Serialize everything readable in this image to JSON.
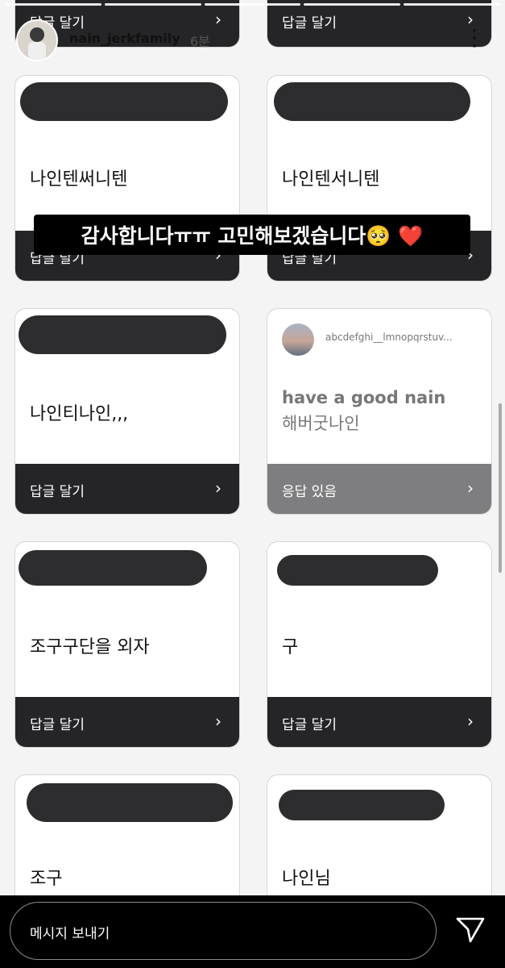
{
  "header": {
    "username": "nain_jerkfamily",
    "time": "6분",
    "more_icon": "⋮"
  },
  "caption": {
    "text": "감사합니다ㅠㅠ 고민해보겠습니다🥺 ❤️"
  },
  "cards": [
    {
      "question": "나인텐써니텐",
      "footer": "답글 달기"
    },
    {
      "question": "나인텐서니텐",
      "footer": "답글 달기"
    },
    {
      "question": "나인티나인,,,",
      "footer": "답글 달기"
    },
    {
      "reply_user": "abcdefghi__lmnopqrstuv...",
      "reply_line1": "have a good nain",
      "reply_line2": "해버굿나인",
      "footer": "응답 있음"
    },
    {
      "question": "조구구단을 외자",
      "footer": "답글 달기"
    },
    {
      "question": "구",
      "footer": "답글 달기"
    },
    {
      "question": "조구"
    },
    {
      "question": "나인님"
    }
  ],
  "top_cards": [
    {
      "footer": "답글 달기"
    },
    {
      "footer": "답글 달기"
    }
  ],
  "chevron": "›",
  "message": {
    "placeholder": "메시지 보내기"
  },
  "colors": {
    "card_footer_dark": "#252528",
    "card_footer_answered": "#7e7e80",
    "redaction": "#2d2d2f"
  }
}
